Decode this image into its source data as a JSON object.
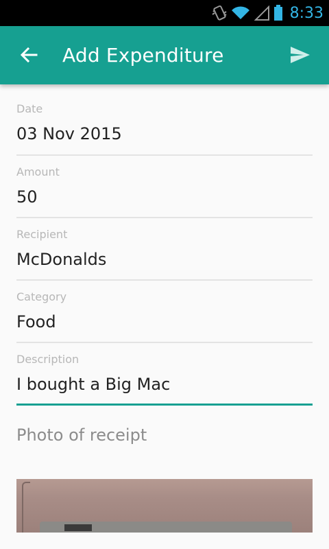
{
  "status_bar": {
    "time": "8:33",
    "icons": [
      "vibrate-icon",
      "wifi-icon",
      "signal-icon",
      "battery-icon"
    ],
    "accent_color": "#33b5e5"
  },
  "app_bar": {
    "title": "Add Expenditure",
    "back_icon": "arrow-back-icon",
    "send_icon": "send-icon",
    "color": "#16a091"
  },
  "form": {
    "fields": [
      {
        "label": "Date",
        "value": "03 Nov 2015"
      },
      {
        "label": "Amount",
        "value": "50"
      },
      {
        "label": "Recipient",
        "value": "McDonalds"
      },
      {
        "label": "Category",
        "value": "Food"
      },
      {
        "label": "Description",
        "value": "I bought a Big Mac"
      }
    ],
    "photo_label": "Photo of receipt"
  }
}
